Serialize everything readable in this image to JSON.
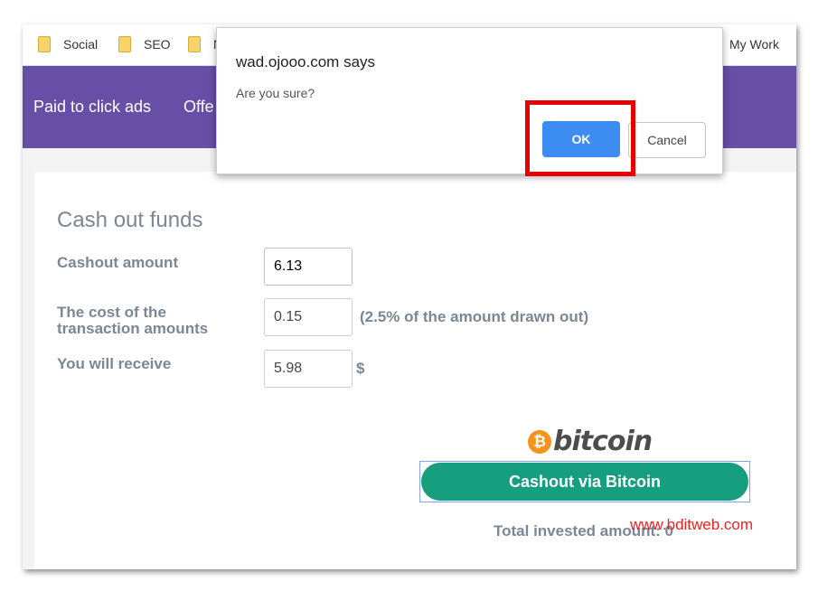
{
  "bookmarks": {
    "items": [
      {
        "label": "Social",
        "icon": "folder-icon"
      },
      {
        "label": "SEO",
        "icon": "folder-icon"
      },
      {
        "label": "N",
        "icon": "folder-icon"
      }
    ],
    "right_label": "My Work"
  },
  "nav": {
    "items": [
      "Paid to click ads",
      "Offe"
    ]
  },
  "page": {
    "title": "Cash out funds",
    "cashout_label": "Cashout amount",
    "cashout_value": "6.13",
    "cost_label_line1": "The cost of the",
    "cost_label_line2": "transaction amounts",
    "cost_value": "0.15",
    "cost_hint": "(2.5% of the amount drawn out)",
    "receive_label": "You will receive",
    "receive_value": "5.98",
    "currency": "$",
    "bitcoin_symbol": "₿",
    "bitcoin_word": "bitcoin",
    "cashout_button": "Cashout via Bitcoin",
    "total_invested": "Total invested amount: 0"
  },
  "dialog": {
    "title": "wad.ojooo.com says",
    "message": "Are you sure?",
    "ok_label": "OK",
    "cancel_label": "Cancel"
  },
  "watermark": "www.bditweb.com",
  "colors": {
    "nav_bg": "#674ea7",
    "cashout_button": "#169e7f",
    "ok_button": "#3c8cf2",
    "highlight": "#e60000",
    "bitcoin_orange": "#f7931a"
  }
}
